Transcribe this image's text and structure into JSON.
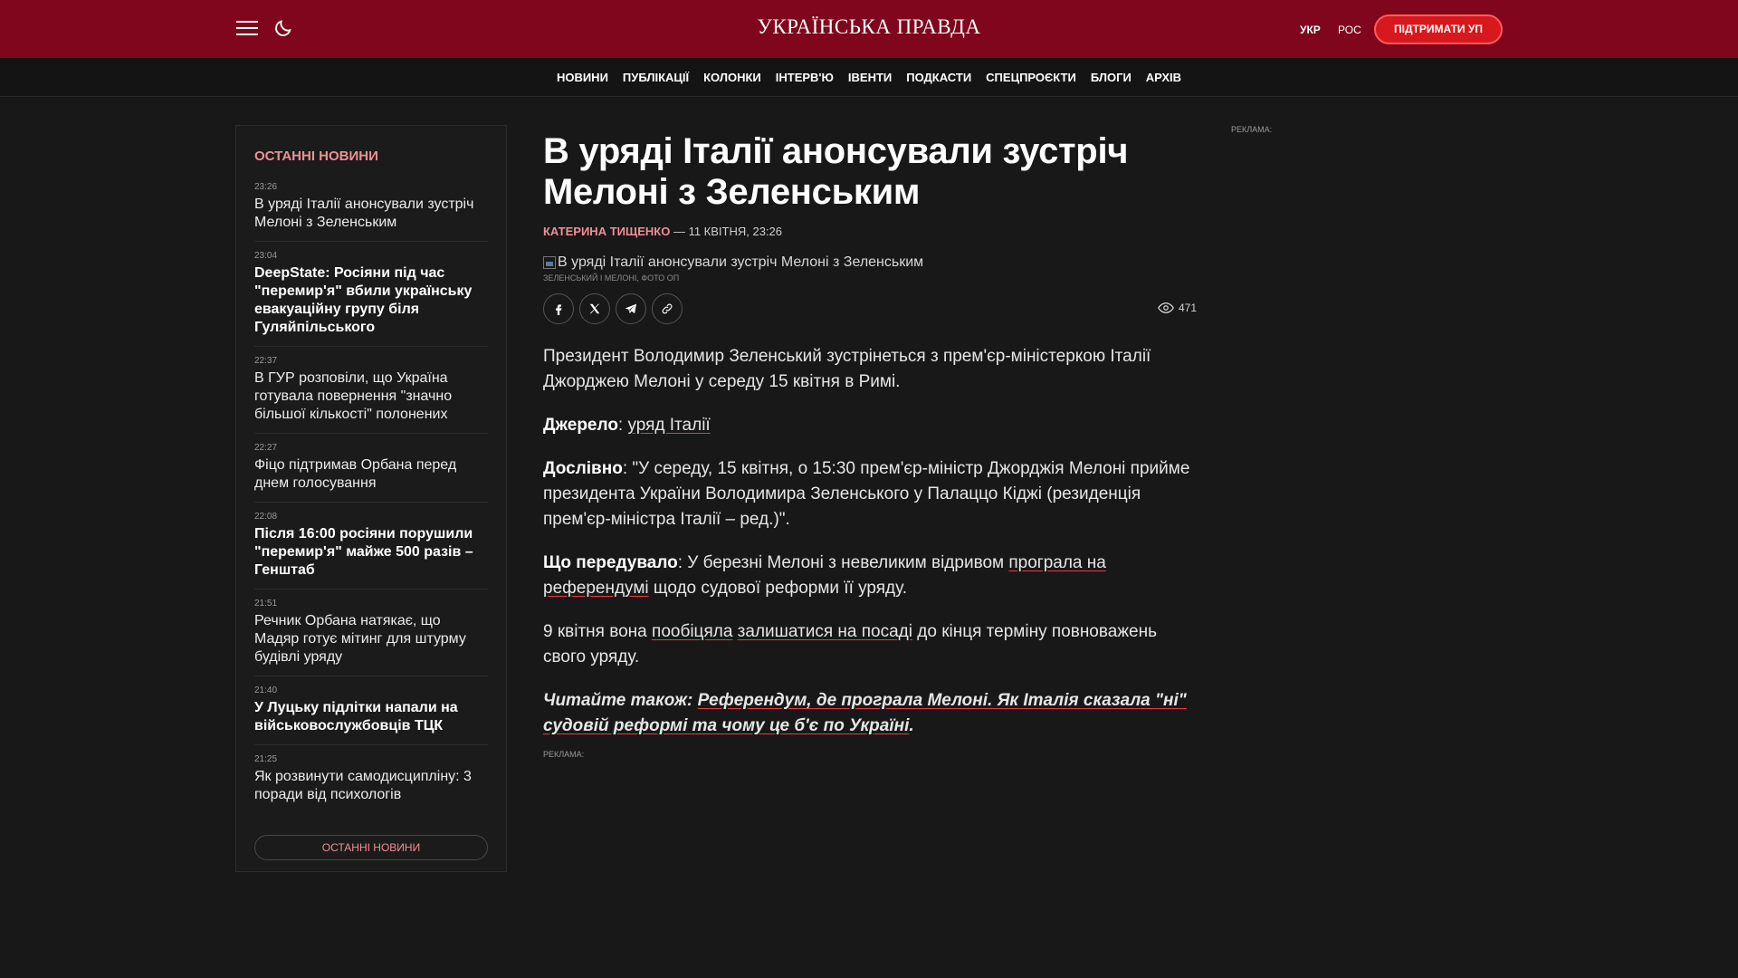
{
  "header": {
    "logo": "УКРАЇНСЬКА ПРАВДА",
    "lang_ukr": "УКР",
    "lang_ros": "РОС",
    "support_label": "ПІДТРИМАТИ УП"
  },
  "nav": {
    "items": [
      "НОВИНИ",
      "ПУБЛІКАЦІЇ",
      "КОЛОНКИ",
      "ІНТЕРВ'Ю",
      "ІВЕНТИ",
      "ПОДКАСТИ",
      "СПЕЦПРОЄКТИ",
      "БЛОГИ",
      "АРХІВ"
    ]
  },
  "sidebar": {
    "title": "ОСТАННІ НОВИНИ",
    "items": [
      {
        "time": "23:26",
        "text": "В уряді Італії анонсували зустріч Мелоні з Зеленським"
      },
      {
        "time": "23:04",
        "text": "DeepState: Росіяни під час \"перемир'я\" вбили українську евакуаційну групу біля Гуляйпільського"
      },
      {
        "time": "22:37",
        "text": "В ГУР розповіли, що Україна готувала повернення \"значно більшої кількості\" полонених"
      },
      {
        "time": "22:27",
        "text": "Фіцо підтримав Орбана перед днем голосування"
      },
      {
        "time": "22:08",
        "text": "Після 16:00 росіяни порушили \"перемир'я\" майже 500 разів – Генштаб"
      },
      {
        "time": "21:51",
        "text": "Речник Орбана натякає, що Мадяр готує мітинг для штурму будівлі уряду"
      },
      {
        "time": "21:40",
        "text": "У Луцьку підлітки напали на військовослужбовців ТЦК"
      },
      {
        "time": "21:25",
        "text": "Як розвинути самодисципліну: 3 поради від психологів"
      }
    ],
    "more_label": "ОСТАННІ НОВИНИ"
  },
  "article": {
    "title": "В уряді Італії анонсували зустріч Мелоні з Зеленським",
    "author": "КАТЕРИНА ТИЩЕНКО",
    "date_sep": " — ",
    "date": "11 КВІТНЯ, 23:26",
    "image_alt": "В уряді Італії анонсували зустріч Мелоні з Зеленським",
    "image_caption": "Зеленський і Мелоні, Фото ОП",
    "views": "471",
    "p1": "Президент Володимир Зеленський зустрінеться з прем'єр-міністеркою Італії Джорджею Мелоні у середу 15 квітня в Римі.",
    "p2_label": "Джерело",
    "p2_colon": ": ",
    "p2_link": "уряд Італії",
    "p3_label": "Дослівно",
    "p3_text": ": \"У середу, 15 квітня, о 15:30 прем'єр-міністр Джорджія Мелоні прийме президента України Володимира Зеленського у Палаццо Кіджі (резиденція прем'єр-міністра Італії – ред.)\".",
    "p4_label": "Що передувало",
    "p4_text1": ": У березні Мелоні з невеликим відривом ",
    "p4_link": "програла на референдумі",
    "p4_text2": " щодо судової реформи її уряду.",
    "p5_text1": "9 квітня вона ",
    "p5_link1": "пообіцяла",
    "p5_space": " ",
    "p5_link2": "залишатися на посаді",
    "p5_text2": " до кінця терміну повноважень свого уряду.",
    "readalso_label": "Читайте також: ",
    "readalso_link": "Референдум, де програла Мелоні. Як Італія сказала \"ні\" судовій реформі та чому це б'є по Україні",
    "readalso_end": ".",
    "ad_label": "РЕКЛАМА:"
  },
  "ad_right": {
    "label": "РЕКЛАМА:"
  },
  "icons": {
    "menu": "hamburger-menu-icon",
    "theme": "moon-icon",
    "share": [
      "facebook-icon",
      "x-icon",
      "telegram-icon",
      "link-icon"
    ],
    "views": "eye-icon"
  },
  "colors": {
    "header_bg": "#7f061d",
    "accent": "#d7191e",
    "accent_text": "#f08f94",
    "background": "#181818"
  }
}
